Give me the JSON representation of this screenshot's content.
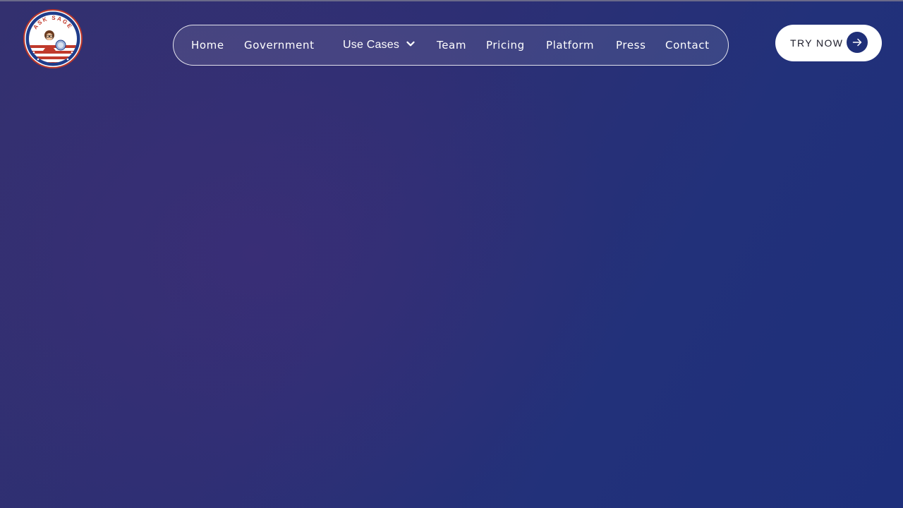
{
  "brand": {
    "logo_text": "ASK SAGE",
    "logo_icon": "ask-sage-seal-logo"
  },
  "nav": {
    "items": [
      {
        "label": "Home"
      },
      {
        "label": "Government"
      },
      {
        "label": "Use Cases",
        "icon": "chevron-down-icon"
      },
      {
        "label": "Team"
      },
      {
        "label": "Pricing"
      },
      {
        "label": "Platform"
      },
      {
        "label": "Press"
      },
      {
        "label": "Contact"
      }
    ]
  },
  "cta": {
    "label": "TRY NOW",
    "icon": "arrow-right-icon"
  },
  "colors": {
    "background_start": "#33306f",
    "background_end": "#1e2f7b",
    "cta_arrow_bg": "#1f2f78",
    "text": "#ffffff"
  }
}
